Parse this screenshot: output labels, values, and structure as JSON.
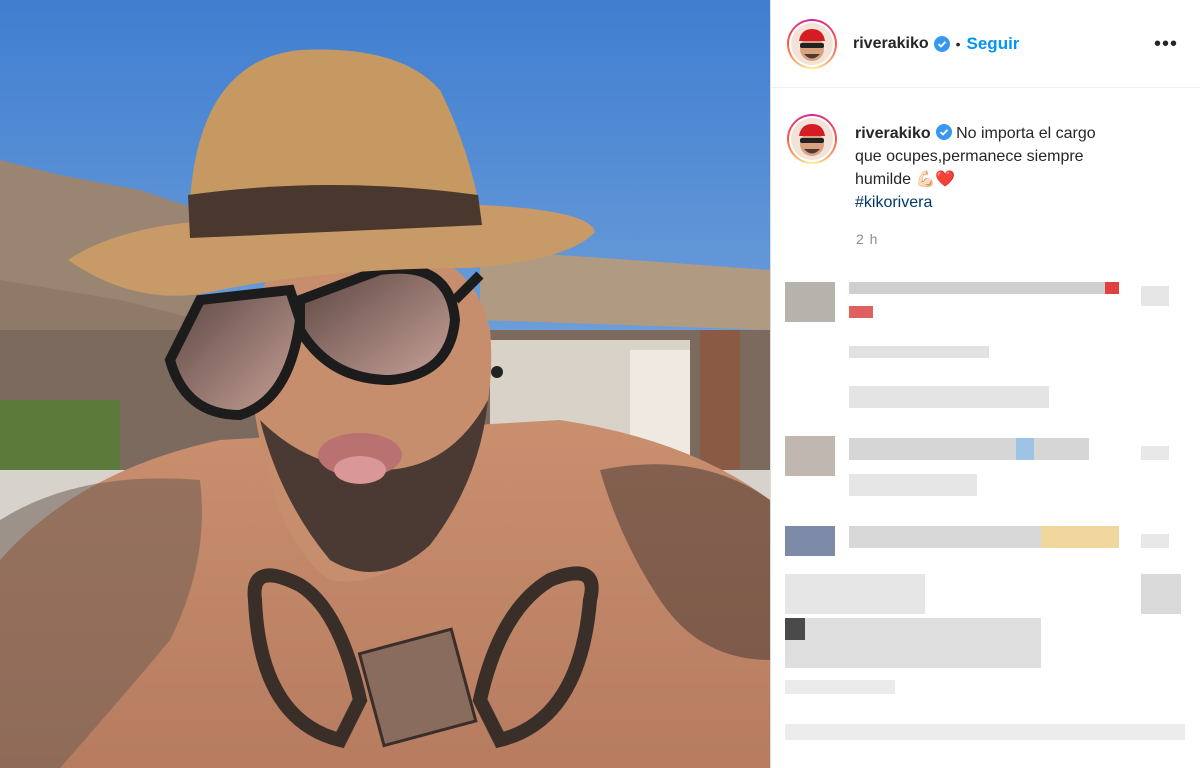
{
  "post": {
    "username": "riverakiko",
    "verified": true,
    "separator": "•",
    "follow_label": "Seguir",
    "more_label": "•••",
    "caption": {
      "username": "riverakiko",
      "text_line1": "No importa el cargo",
      "text_line2": "que ocupes,permanece siempre",
      "text_line3": "humilde 💪🏻❤️",
      "hashtag": "#kikorivera"
    },
    "time": "2 h"
  },
  "colors": {
    "follow": "#0095f6",
    "hashtag": "#00376b",
    "verified_badge": "#3897f0",
    "time": "#8e8e8e"
  },
  "icons": [
    "verified-badge-icon",
    "more-options-icon"
  ]
}
